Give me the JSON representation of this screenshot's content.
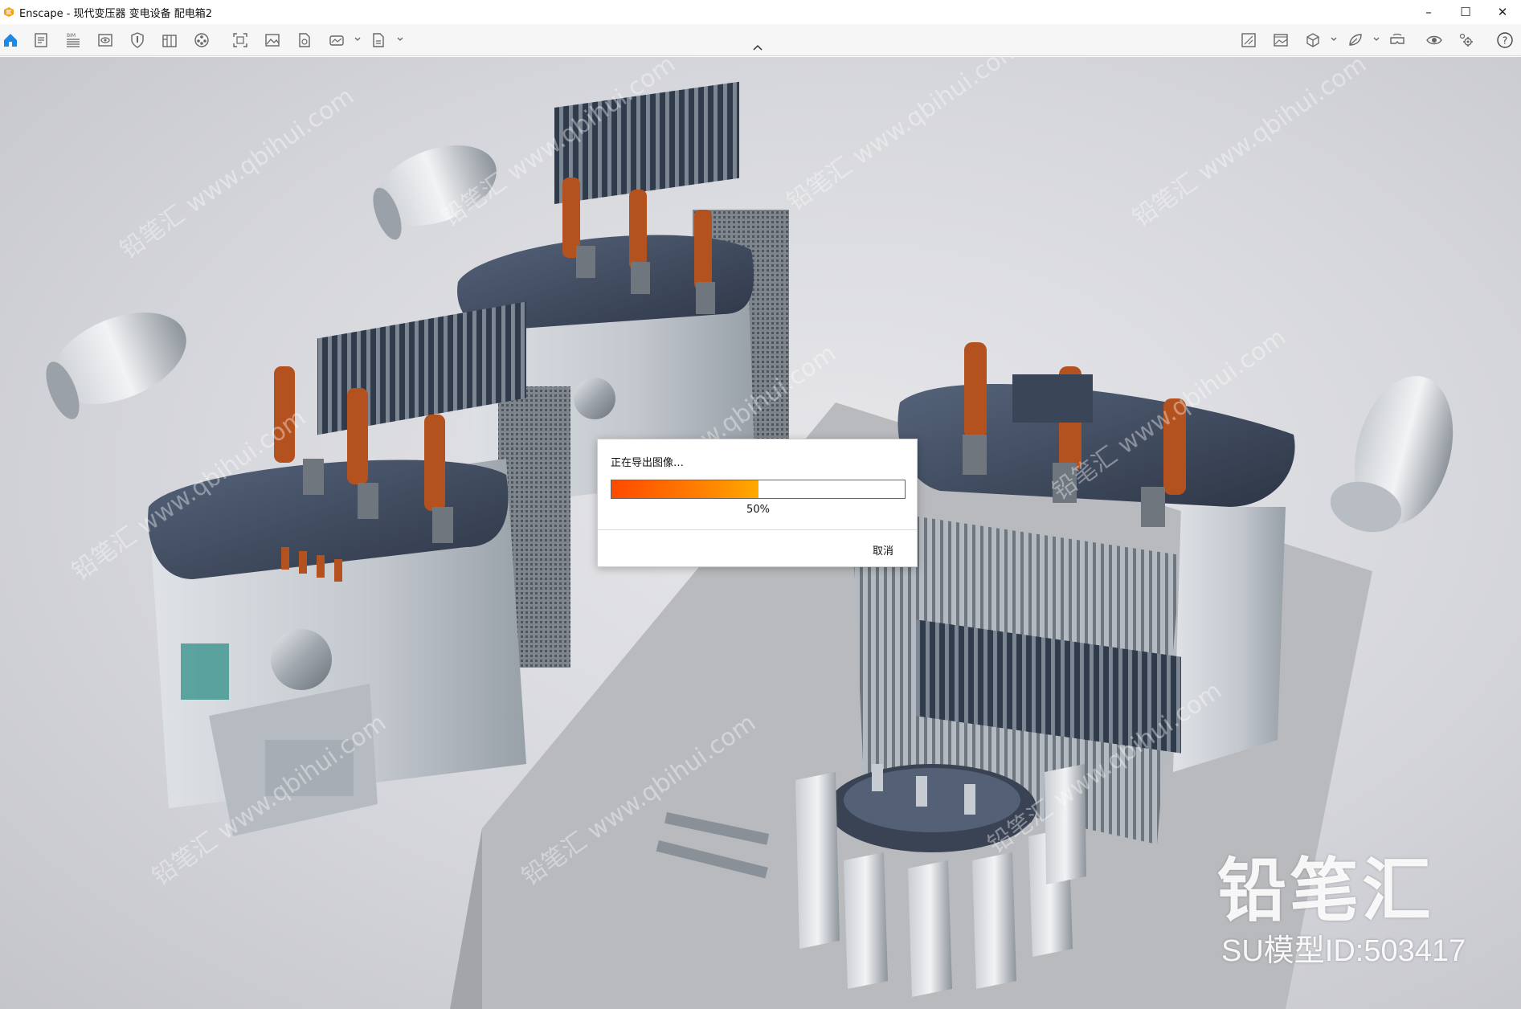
{
  "window": {
    "title": "Enscape - 现代变压器 变电设备 配电箱2",
    "controls": {
      "minimize": "–",
      "maximize": "☐",
      "close": "✕"
    }
  },
  "toolbar": {
    "left_icons": [
      "home-icon",
      "document-icon",
      "bim-icon",
      "view-icon",
      "shield-icon",
      "library-icon",
      "video-icon",
      "screenshot-icon",
      "image-icon",
      "export-file-icon",
      "panorama-icon",
      "exe-export-icon"
    ],
    "bim_label": "BIM",
    "right_icons": [
      "views-icon",
      "gallery-icon",
      "cube-icon",
      "material-icon",
      "vr-headset-icon",
      "eye-icon",
      "settings-icon",
      "help-icon"
    ],
    "help_label": "?"
  },
  "dialog": {
    "title": "正在导出图像…",
    "progress": 0.5,
    "progress_text": "50%",
    "cancel_label": "取消"
  },
  "watermark": {
    "brand": "铅笔汇",
    "model_id": "SU模型ID:503417",
    "tile_text": "铅笔汇 www.qbihui.com"
  },
  "colors": {
    "accent": "#ff6a00",
    "home_blue": "#1e88e5",
    "bushing": "#b4521f"
  }
}
